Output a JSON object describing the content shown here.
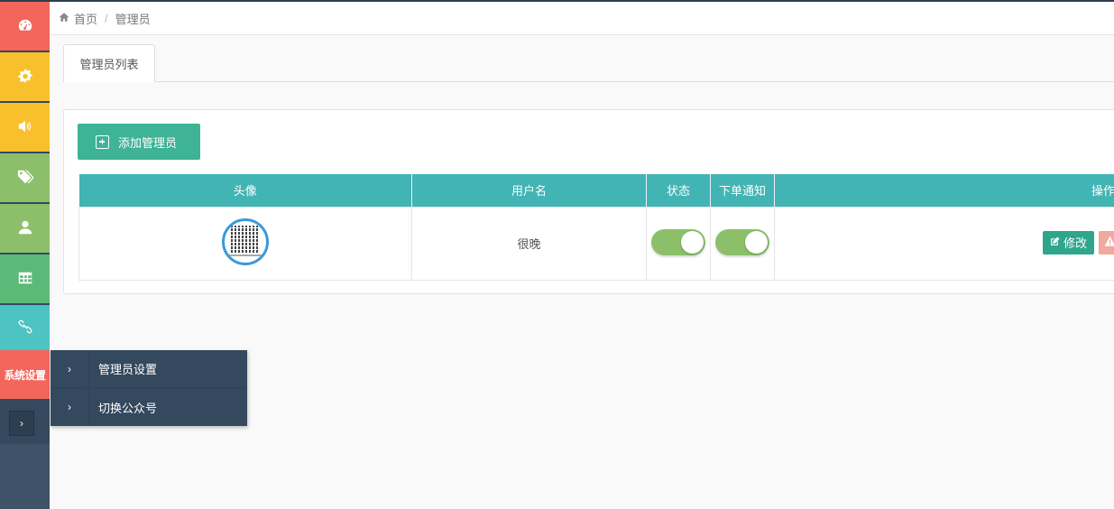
{
  "sidebar": {
    "items": [
      {
        "icon": "dashboard-icon",
        "color": "#f3665b"
      },
      {
        "icon": "gear-icon",
        "color": "#f8c02b"
      },
      {
        "icon": "volume-icon",
        "color": "#f8c02b"
      },
      {
        "icon": "tags-icon",
        "color": "#8cbf6a"
      },
      {
        "icon": "user-icon",
        "color": "#8cbf6a"
      },
      {
        "icon": "table-icon",
        "color": "#5cba78"
      },
      {
        "icon": "link-icon",
        "color": "#4dc3c3"
      }
    ],
    "active_label": "系统设置",
    "expand_glyph": "›"
  },
  "flyout": {
    "items": [
      {
        "glyph": "›",
        "label": "管理员设置"
      },
      {
        "glyph": "›",
        "label": "切换公众号"
      }
    ]
  },
  "breadcrumb": {
    "home": "首页",
    "sep": "/",
    "current": "管理员"
  },
  "tabs": [
    {
      "label": "管理员列表"
    }
  ],
  "panel": {
    "add_button": "添加管理员",
    "table": {
      "headers": [
        "头像",
        "用户名",
        "状态",
        "下单通知",
        "操作"
      ],
      "rows": [
        {
          "username": "很晚",
          "status": true,
          "order_notify": true,
          "edit_label": "修改"
        }
      ]
    }
  }
}
